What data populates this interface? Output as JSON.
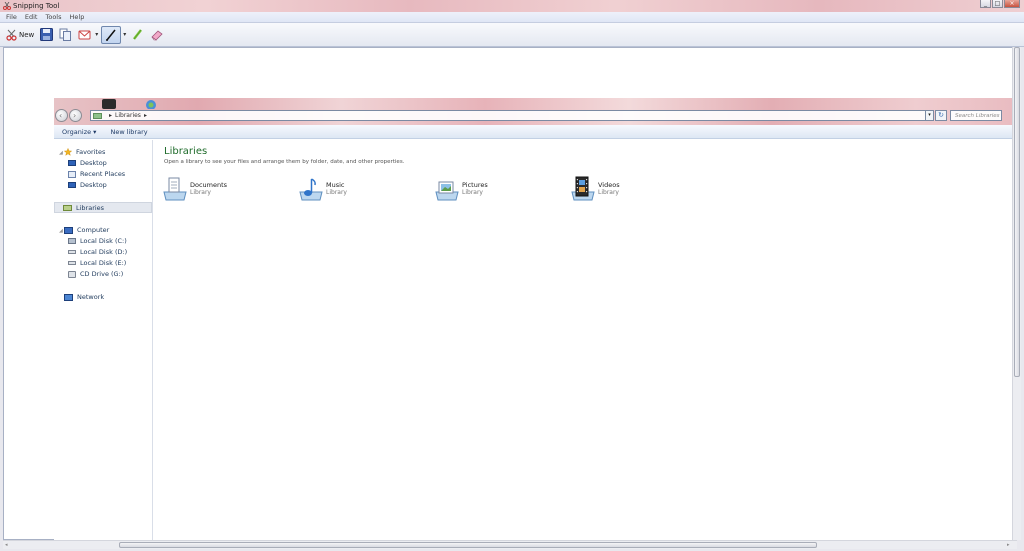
{
  "window": {
    "title": "Snipping Tool",
    "controls": [
      "_",
      "□",
      "×"
    ]
  },
  "menu": [
    "File",
    "Edit",
    "Tools",
    "Help"
  ],
  "toolbar": {
    "new_label": "New",
    "icons": [
      "new-snip-icon",
      "save-icon",
      "copy-icon",
      "send-snip-icon",
      "pen-icon",
      "highlighter-icon",
      "eraser-icon"
    ]
  },
  "explorer": {
    "address": {
      "crumbs": [
        "Libraries"
      ]
    },
    "search_placeholder": "Search Libraries",
    "commands": [
      "Organize ▾",
      "New library"
    ],
    "nav": {
      "favorites": "Favorites",
      "favorites_items": [
        "Desktop",
        "Recent Places",
        "Desktop"
      ],
      "libraries": "Libraries",
      "computer": "Computer",
      "computer_items": [
        "Local Disk (C:)",
        "Local Disk (D:)",
        "Local Disk (E:)",
        "CD Drive (G:)"
      ],
      "network": "Network"
    },
    "content": {
      "title": "Libraries",
      "subtitle": "Open a library to see your files and arrange them by folder, date, and other properties.",
      "libraries": [
        {
          "name": "Documents",
          "kind": "Library",
          "icon": "documents-library-icon"
        },
        {
          "name": "Music",
          "kind": "Library",
          "icon": "music-library-icon"
        },
        {
          "name": "Pictures",
          "kind": "Library",
          "icon": "pictures-library-icon"
        },
        {
          "name": "Videos",
          "kind": "Library",
          "icon": "videos-library-icon"
        }
      ]
    }
  },
  "colors": {
    "title_gradient": "#e7b9bf",
    "link_text": "#1e395b",
    "content_title": "#1e6b2a"
  }
}
